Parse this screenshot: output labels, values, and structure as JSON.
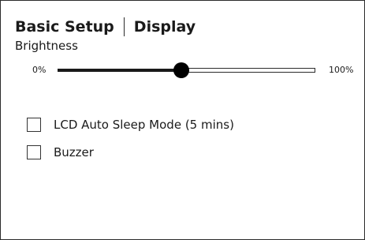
{
  "header": {
    "title": "Basic Setup",
    "section": "Display"
  },
  "brightness": {
    "label": "Brightness",
    "min_label": "0%",
    "max_label": "100%",
    "value": 48
  },
  "options": [
    {
      "label": "LCD Auto Sleep Mode (5 mins)",
      "checked": false
    },
    {
      "label": "Buzzer",
      "checked": false
    }
  ],
  "colors": {
    "text": "#1a1a1a",
    "border": "#2b2b2b",
    "thumb": "#000000",
    "background": "#ffffff"
  }
}
